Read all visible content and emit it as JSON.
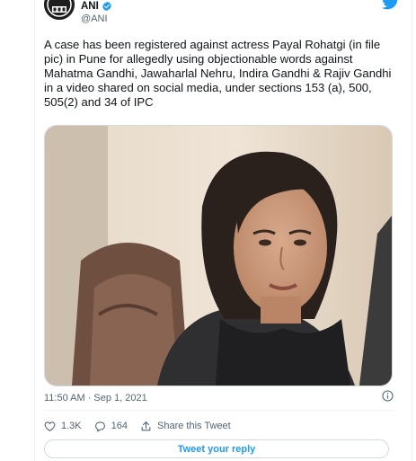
{
  "author": {
    "name": "ANI",
    "handle": "@ANI",
    "verified": true,
    "avatar_icon": "ani-logo",
    "verified_icon": "verified-badge-icon"
  },
  "tweet": {
    "text": "A case has been registered against actress Payal Rohatgi (in file pic) in Pune for allegedly using objectionable words against Mahatma Gandhi, Jawaharlal Nehru, Indira Gandhi & Rajiv Gandhi in a video shared on social media, under sections 153 (a), 500, 505(2) and 34 of IPC",
    "timestamp": "11:50 AM · Sep 1, 2021"
  },
  "actions": {
    "likes": "1.3K",
    "replies": "164",
    "share_label": "Share this Tweet",
    "reply_button_label": "Tweet your reply"
  },
  "icons": {
    "brand": "twitter-bird-icon",
    "info": "info-icon",
    "like": "heart-icon",
    "reply": "reply-icon",
    "share": "share-icon"
  },
  "colors": {
    "accent": "#1d9bf0",
    "text": "#0f1419",
    "secondary": "#536471",
    "border": "#cfd9de"
  }
}
